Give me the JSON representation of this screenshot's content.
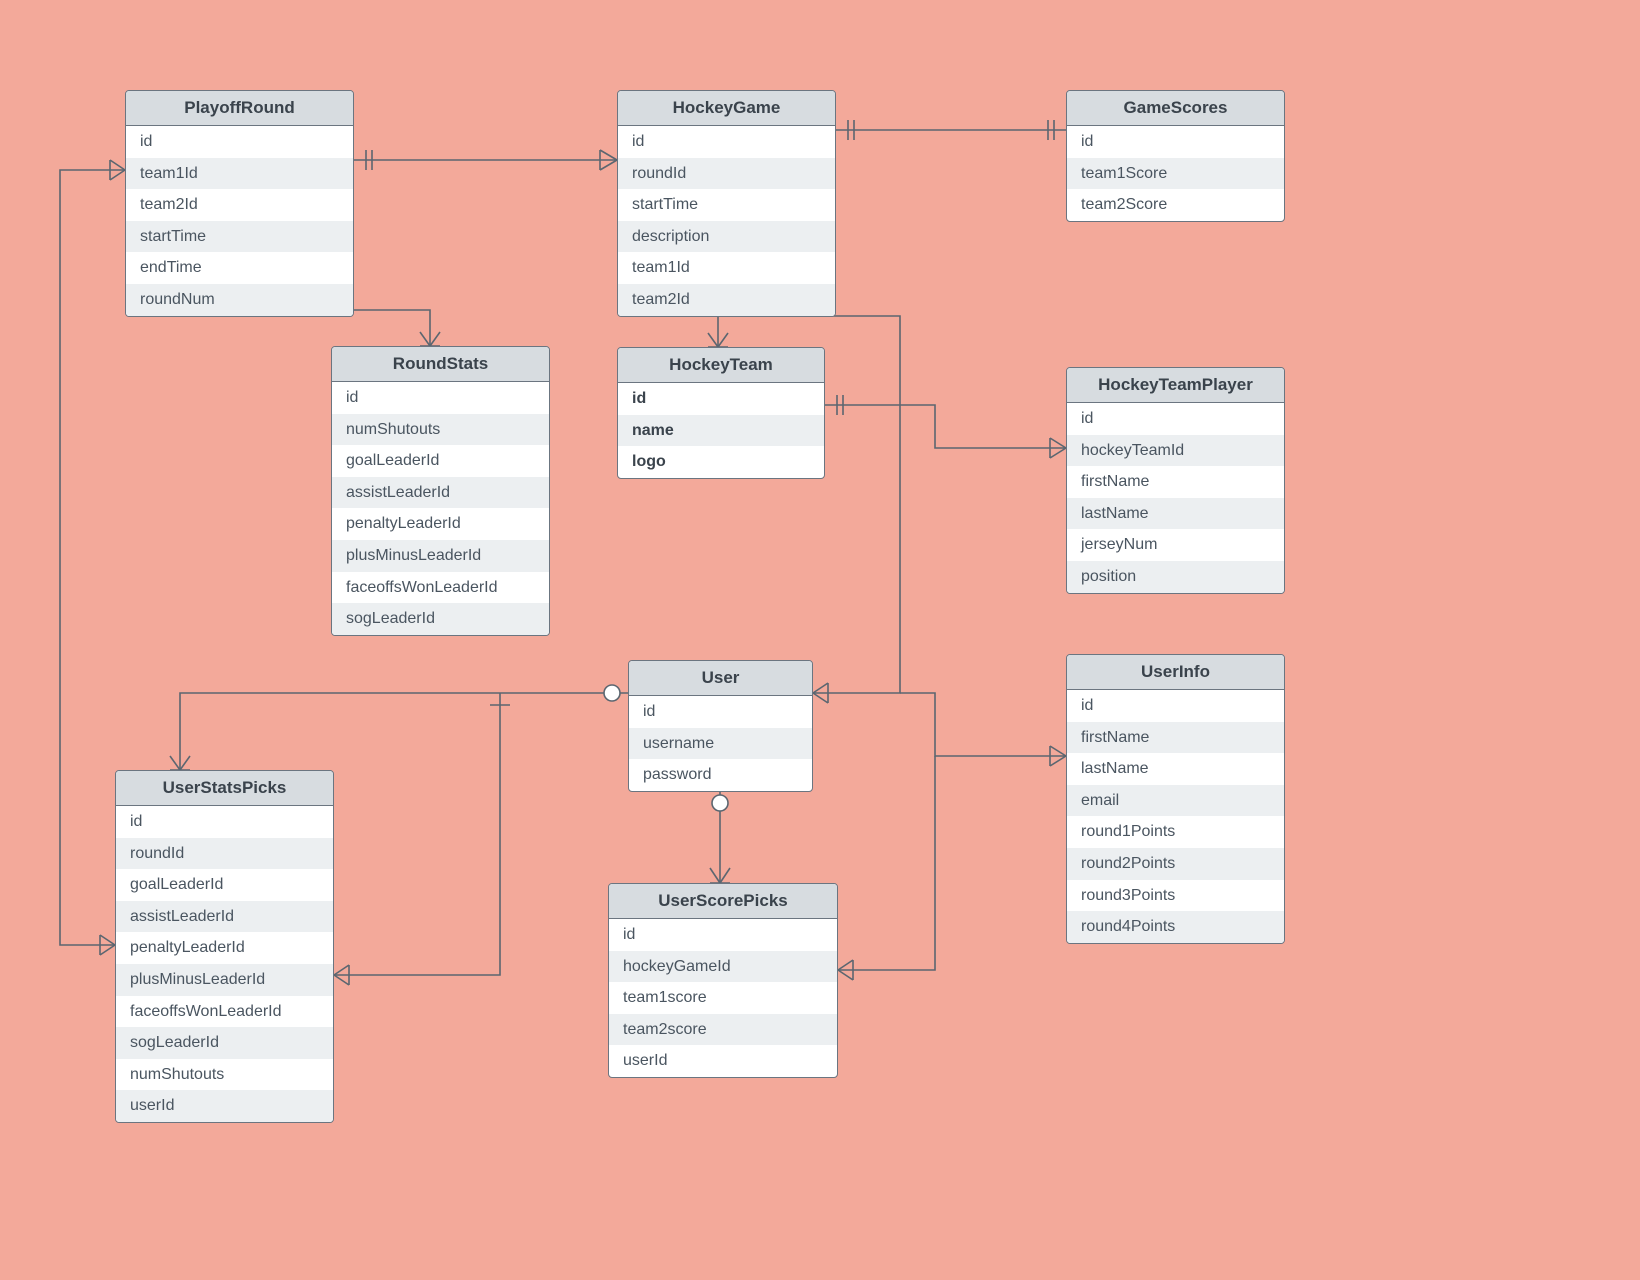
{
  "entities": {
    "playoffRound": {
      "title": "PlayoffRound",
      "attrs": [
        "id",
        "team1Id",
        "team2Id",
        "startTime",
        "endTime",
        "roundNum"
      ]
    },
    "hockeyGame": {
      "title": "HockeyGame",
      "attrs": [
        "id",
        "roundId",
        "startTime",
        "description",
        "team1Id",
        "team2Id"
      ]
    },
    "gameScores": {
      "title": "GameScores",
      "attrs": [
        "id",
        "team1Score",
        "team2Score"
      ]
    },
    "roundStats": {
      "title": "RoundStats",
      "attrs": [
        "id",
        "numShutouts",
        "goalLeaderId",
        "assistLeaderId",
        "penaltyLeaderId",
        "plusMinusLeaderId",
        "faceoffsWonLeaderId",
        "sogLeaderId"
      ]
    },
    "hockeyTeam": {
      "title": "HockeyTeam",
      "attrs_bold": true,
      "attrs": [
        "id",
        "name",
        "logo"
      ]
    },
    "hockeyTeamPlayer": {
      "title": "HockeyTeamPlayer",
      "attrs": [
        "id",
        "hockeyTeamId",
        "firstName",
        "lastName",
        "jerseyNum",
        "position"
      ]
    },
    "userInfo": {
      "title": "UserInfo",
      "attrs": [
        "id",
        "firstName",
        "lastName",
        "email",
        "round1Points",
        "round2Points",
        "round3Points",
        "round4Points"
      ]
    },
    "user": {
      "title": "User",
      "attrs": [
        "id",
        "username",
        "password"
      ]
    },
    "userStatsPicks": {
      "title": "UserStatsPicks",
      "attrs": [
        "id",
        "roundId",
        "goalLeaderId",
        "assistLeaderId",
        "penaltyLeaderId",
        "plusMinusLeaderId",
        "faceoffsWonLeaderId",
        "sogLeaderId",
        "numShutouts",
        "userId"
      ]
    },
    "userScorePicks": {
      "title": "UserScorePicks",
      "attrs": [
        "id",
        "hockeyGameId",
        "team1score",
        "team2score",
        "userId"
      ]
    }
  }
}
